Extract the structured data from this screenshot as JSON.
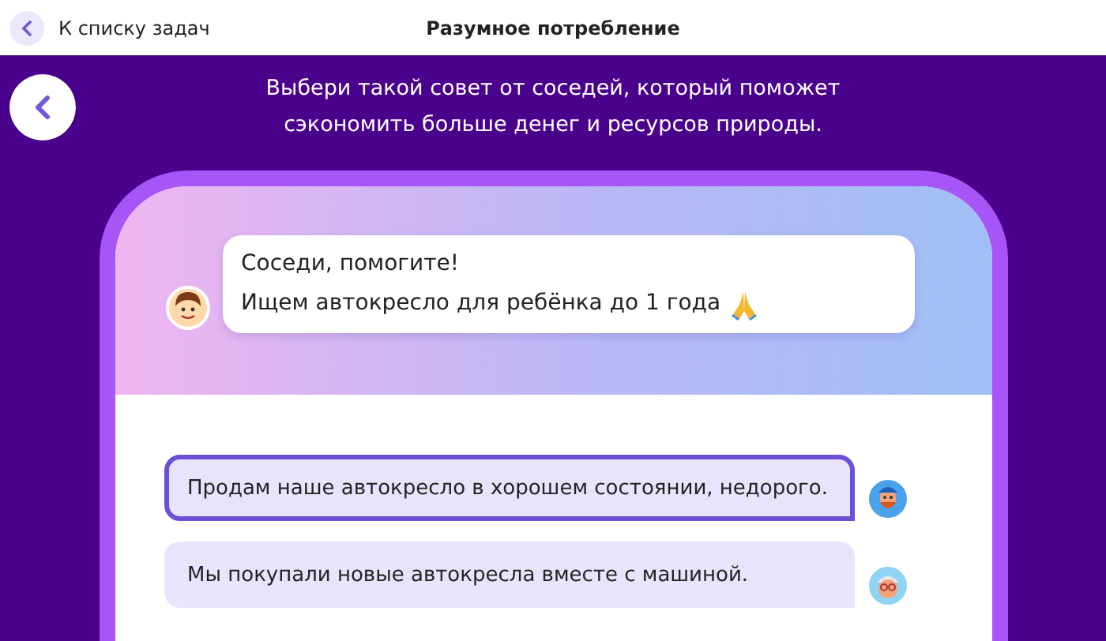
{
  "top_bar": {
    "back_label": "К списку задач",
    "title": "Разумное потребление"
  },
  "instruction": "Выбери такой совет от соседей, который поможет сэкономить больше денег и ресурсов природы.",
  "question": {
    "lines": [
      "Соседи, помогите!",
      "Ищем автокресло для ребёнка до 1 года"
    ]
  },
  "options": [
    {
      "text": "Продам наше автокресло в хорошем состоянии, недорого.",
      "selected": true
    },
    {
      "text": "Мы покупали новые автокресла вместе с машиной.",
      "selected": false
    }
  ]
}
